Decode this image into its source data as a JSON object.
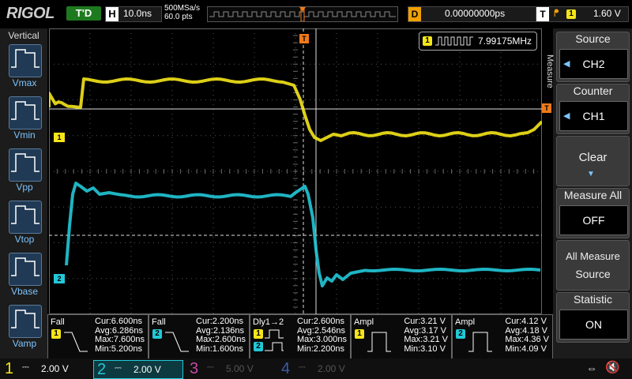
{
  "brand": "RIGOL",
  "run_status": "T'D",
  "horizontal": {
    "label": "H",
    "timebase": "10.0ns"
  },
  "sample": {
    "rate": "500MSa/s",
    "points": "60.0 pts"
  },
  "delay": {
    "label": "D",
    "value": "0.00000000ps"
  },
  "trigger": {
    "label": "T",
    "channel": "1",
    "level": "1.60 V"
  },
  "left_panel": {
    "title": "Vertical",
    "items": [
      "Vmax",
      "Vmin",
      "Vpp",
      "Vtop",
      "Vbase",
      "Vamp"
    ]
  },
  "right_panel": {
    "tab_label": "Measure",
    "source": {
      "title": "Source",
      "value": "CH2"
    },
    "counter": {
      "title": "Counter",
      "value": "CH1"
    },
    "clear": {
      "title": "Clear"
    },
    "measure_all": {
      "title": "Measure All",
      "value": "OFF"
    },
    "all_measure_source": {
      "line1": "All Measure",
      "line2": "Source"
    },
    "statistic": {
      "title": "Statistic",
      "value": "ON"
    }
  },
  "frequency_counter": {
    "channel": "1",
    "value": "7.99175MHz"
  },
  "markers": {
    "ch1": "1",
    "ch2": "2",
    "trigger": "T"
  },
  "measurements": [
    {
      "name": "Fall",
      "channel": "1",
      "cur": "Cur:6.600ns",
      "avg": "Avg:6.286ns",
      "max": "Max:7.600ns",
      "min": "Min:5.200ns"
    },
    {
      "name": "Fall",
      "channel": "2",
      "cur": "Cur:2.200ns",
      "avg": "Avg:2.136ns",
      "max": "Max:2.600ns",
      "min": "Min:1.600ns"
    },
    {
      "name": "Dly1→2",
      "channel": "1",
      "cur": "Cur:2.600ns",
      "avg": "Avg:2.546ns",
      "max": "Max:3.000ns",
      "min": "Min:2.200ns"
    },
    {
      "name": "Ampl",
      "channel": "1",
      "cur": "Cur:3.21 V",
      "avg": "Avg:3.17 V",
      "max": "Max:3.21 V",
      "min": "Min:3.10 V"
    },
    {
      "name": "Ampl",
      "channel": "2",
      "cur": "Cur:4.12 V",
      "avg": "Avg:4.18 V",
      "max": "Max:4.36 V",
      "min": "Min:4.09 V"
    }
  ],
  "channels": [
    {
      "num": "1",
      "scale": "2.00 V",
      "color": "#f5e51a",
      "active": true
    },
    {
      "num": "2",
      "scale": "2.00 V",
      "color": "#22c8d8",
      "active": true
    },
    {
      "num": "3",
      "scale": "5.00 V",
      "color": "#c04aa8",
      "active": false
    },
    {
      "num": "4",
      "scale": "2.00 V",
      "color": "#3a5aa8",
      "active": false
    }
  ],
  "colors": {
    "ch1": "#f5e51a",
    "ch2": "#22c8d8",
    "trigger": "#f07a1a",
    "accent": "#7cc4ff"
  },
  "icons": {
    "usb": "usb-icon",
    "speaker": "speaker-mute-icon"
  }
}
